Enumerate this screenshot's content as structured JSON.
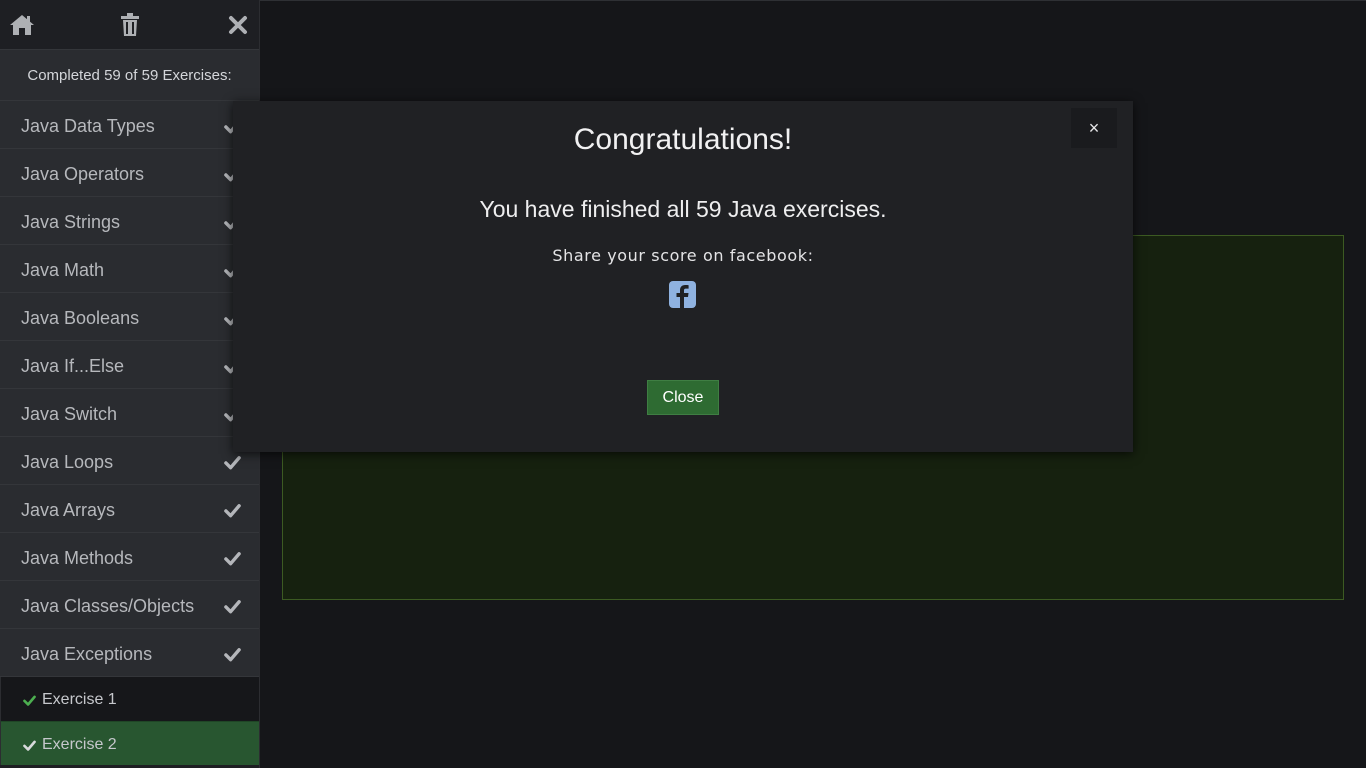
{
  "sidebar": {
    "progress_text": "Completed 59 of 59 Exercises:",
    "categories": [
      {
        "label": "Java Data Types"
      },
      {
        "label": "Java Operators"
      },
      {
        "label": "Java Strings"
      },
      {
        "label": "Java Math"
      },
      {
        "label": "Java Booleans"
      },
      {
        "label": "Java If...Else"
      },
      {
        "label": "Java Switch"
      },
      {
        "label": "Java Loops"
      },
      {
        "label": "Java Arrays"
      },
      {
        "label": "Java Methods"
      },
      {
        "label": "Java Classes/Objects"
      },
      {
        "label": "Java Exceptions"
      }
    ],
    "exercises": [
      {
        "label": "Exercise 1",
        "active": false
      },
      {
        "label": "Exercise 2",
        "active": true
      }
    ]
  },
  "modal": {
    "title": "Congratulations!",
    "message": "You have finished all 59 Java exercises.",
    "share_text": "Share your score on facebook:",
    "close_symbol": "×",
    "close_button": "Close"
  },
  "icons": {
    "home": "home-icon",
    "trash": "trash-icon",
    "close": "close-icon",
    "check": "checkmark-icon",
    "facebook": "facebook-icon"
  },
  "colors": {
    "accent_green": "#2e6b32",
    "check_green": "#4caf50",
    "facebook_blue": "#8fb2e0"
  }
}
